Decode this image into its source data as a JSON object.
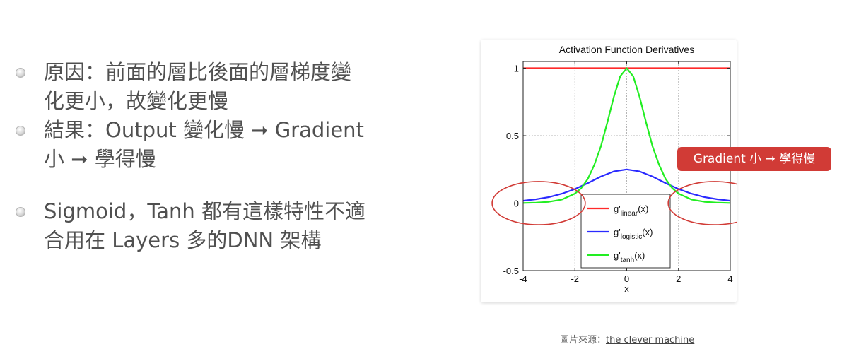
{
  "bullets": [
    {
      "line1": "原因：前面的層比後面的層梯度變",
      "line2": "化更小，故變化更慢"
    },
    {
      "line1": "結果：Output 變化慢 ➞ Gradient",
      "line2": "小 ➞ 學得慢"
    },
    {
      "line1": "Sigmoid，Tanh 都有這樣特性不適",
      "line2": "合用在 Layers 多的DNN 架構"
    }
  ],
  "callout": {
    "text": "Gradient 小 ➞ 學得慢"
  },
  "source": {
    "label": "圖片來源：",
    "link_text": "the clever machine"
  },
  "chart_data": {
    "type": "line",
    "title": "Activation Function Derivatives",
    "xlabel": "x",
    "ylabel": "",
    "xlim": [
      -4,
      4
    ],
    "ylim": [
      -0.5,
      1.05
    ],
    "x_ticks": [
      -4,
      -2,
      0,
      2,
      4
    ],
    "y_ticks": [
      -0.5,
      0,
      0.5,
      1
    ],
    "grid": true,
    "legend_position": "bottom-center",
    "series": [
      {
        "name": "g'linear(x)",
        "label_base": "g'",
        "label_sub": "linear",
        "label_arg": "(x)",
        "color": "#ff2a2a",
        "x": [
          -4,
          -3.5,
          -3,
          -2.5,
          -2,
          -1.5,
          -1,
          -0.5,
          0,
          0.5,
          1,
          1.5,
          2,
          2.5,
          3,
          3.5,
          4
        ],
        "y": [
          1,
          1,
          1,
          1,
          1,
          1,
          1,
          1,
          1,
          1,
          1,
          1,
          1,
          1,
          1,
          1,
          1
        ]
      },
      {
        "name": "g'logistic(x)",
        "label_base": "g'",
        "label_sub": "logistic",
        "label_arg": "(x)",
        "color": "#2a2aff",
        "x": [
          -4,
          -3.5,
          -3,
          -2.5,
          -2,
          -1.5,
          -1,
          -0.5,
          0,
          0.5,
          1,
          1.5,
          2,
          2.5,
          3,
          3.5,
          4
        ],
        "y": [
          0.018,
          0.029,
          0.045,
          0.07,
          0.105,
          0.149,
          0.197,
          0.235,
          0.25,
          0.235,
          0.197,
          0.149,
          0.105,
          0.07,
          0.045,
          0.029,
          0.018
        ]
      },
      {
        "name": "g'tanh(x)",
        "label_base": "g'",
        "label_sub": "tanh",
        "label_arg": "(x)",
        "color": "#22ee22",
        "x": [
          -4,
          -3.5,
          -3,
          -2.5,
          -2,
          -1.75,
          -1.5,
          -1.25,
          -1,
          -0.75,
          -0.5,
          -0.25,
          0,
          0.25,
          0.5,
          0.75,
          1,
          1.25,
          1.5,
          1.75,
          2,
          2.5,
          3,
          3.5,
          4
        ],
        "y": [
          0.001,
          0.004,
          0.01,
          0.027,
          0.071,
          0.113,
          0.181,
          0.284,
          0.42,
          0.596,
          0.786,
          0.94,
          1,
          0.94,
          0.786,
          0.596,
          0.42,
          0.284,
          0.181,
          0.113,
          0.071,
          0.027,
          0.01,
          0.004,
          0.001
        ]
      }
    ],
    "annotations": [
      {
        "type": "ellipse",
        "color": "#d13b36",
        "center": [
          -3.4,
          0
        ],
        "radius": [
          1.8,
          0.16
        ]
      },
      {
        "type": "ellipse",
        "color": "#d13b36",
        "center": [
          3.4,
          0
        ],
        "radius": [
          1.8,
          0.16
        ]
      }
    ]
  }
}
